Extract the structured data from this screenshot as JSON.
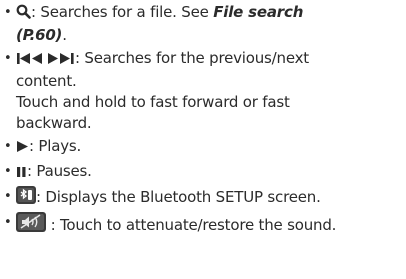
{
  "items": [
    {
      "icon": "search-icon",
      "text": ": Searches for a file. See ",
      "link": "File search",
      "link_ref": "(P.60)",
      "tail": "."
    },
    {
      "icon": "previous-next-icon",
      "text_line1": ": Searches for the previous/next",
      "text_line2": "content.",
      "text_line3": "Touch and hold to fast forward or fast",
      "text_line4": "backward."
    },
    {
      "icon": "play-icon",
      "text": ": Plays."
    },
    {
      "icon": "pause-icon",
      "text": ": Pauses."
    },
    {
      "icon": "bluetooth-setup-icon",
      "text": ": Displays the Bluetooth SETUP screen."
    },
    {
      "icon": "mute-icon",
      "text": " : Touch to attenuate/restore the sound."
    }
  ],
  "bullet": "•"
}
